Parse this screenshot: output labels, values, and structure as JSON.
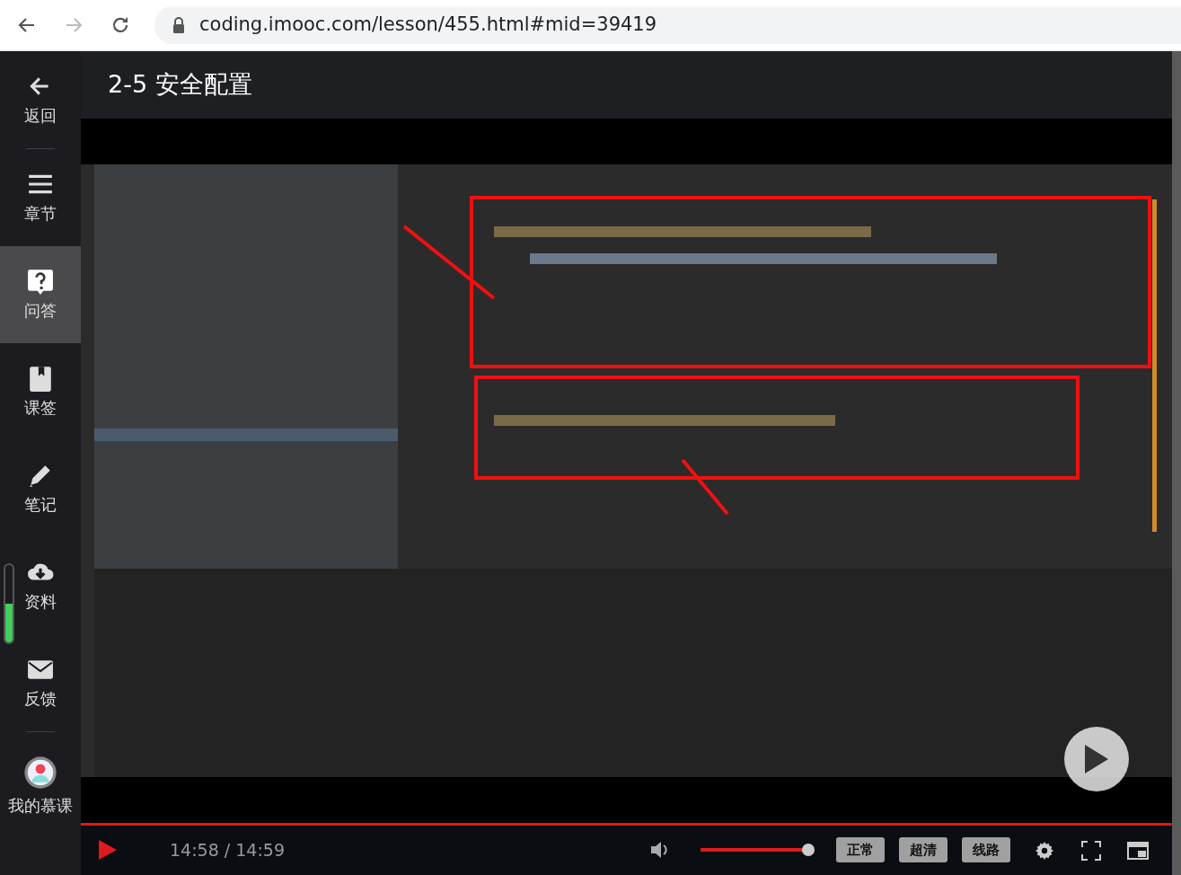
{
  "browser": {
    "url": "coding.imooc.com/lesson/455.html#mid=39419"
  },
  "sidebar": {
    "items": [
      {
        "kind": "back",
        "label": "返回",
        "selected": false
      },
      {
        "kind": "chapters",
        "label": "章节",
        "selected": false
      },
      {
        "kind": "qa",
        "label": "问答",
        "selected": true
      },
      {
        "kind": "bookmark",
        "label": "课签",
        "selected": false
      },
      {
        "kind": "notes",
        "label": "笔记",
        "selected": false
      },
      {
        "kind": "download",
        "label": "资料",
        "selected": false
      },
      {
        "kind": "feedback",
        "label": "反馈",
        "selected": false
      },
      {
        "kind": "avatar",
        "label": "我的慕课",
        "selected": false
      }
    ],
    "meter": {
      "level": 0.5
    }
  },
  "lesson": {
    "title": "2-5 安全配置"
  },
  "player": {
    "progress": {
      "level": 0.999
    },
    "time": "14:58 / 14:59",
    "volume": {
      "level": 1
    },
    "buttons": [
      "正常",
      "超清",
      "线路"
    ]
  }
}
